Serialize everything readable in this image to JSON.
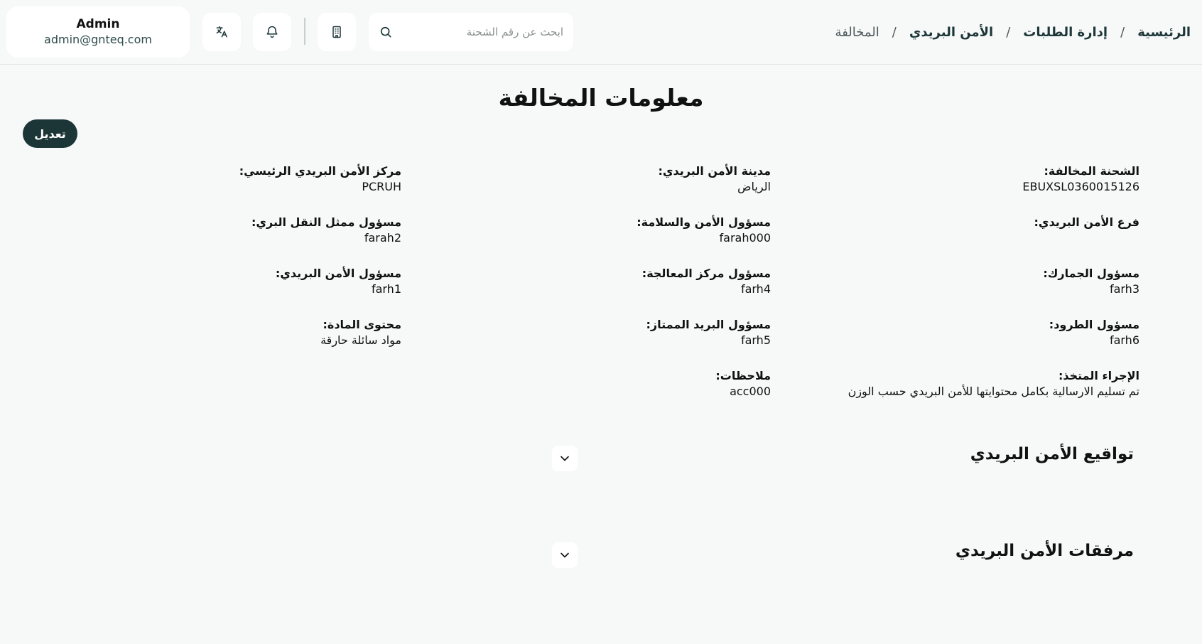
{
  "header": {
    "user": {
      "name": "Admin",
      "email": "admin@gnteq.com"
    },
    "search": {
      "placeholder": "ابحث عن رقم الشحنة"
    },
    "icons": {
      "translate": "translate-icon",
      "notifications": "bell-icon",
      "building": "building-icon",
      "search": "search-icon"
    },
    "breadcrumb": {
      "home": "الرئيسية",
      "requests": "إدارة الطلبات",
      "postal_security": "الأمن البريدي",
      "current": "المخالفة",
      "separator": "/"
    }
  },
  "page": {
    "title": "معلومات المخالفة",
    "edit_label": "تعديل"
  },
  "fields": {
    "shipment": {
      "label": "الشحنة المخالفة:",
      "value": "EBUXSL0360015126"
    },
    "city": {
      "label": "مدينة الأمن البريدي:",
      "value": "الرياض"
    },
    "main_center": {
      "label": "مركز الأمن البريدي الرئيسي:",
      "value": "PCRUH"
    },
    "branch": {
      "label": "فرع الأمن البريدي:",
      "value": ""
    },
    "safety_officer": {
      "label": "مسؤول الأمن والسلامة:",
      "value": "farah000"
    },
    "land_transport": {
      "label": "مسؤول ممثل النقل البري:",
      "value": "farah2"
    },
    "customs": {
      "label": "مسؤول الجمارك:",
      "value": "farh3"
    },
    "processing_center": {
      "label": "مسؤول مركز المعالجة:",
      "value": "farh4"
    },
    "postal_security_officer": {
      "label": "مسؤول الأمن البريدي:",
      "value": "farh1"
    },
    "parcels": {
      "label": "مسؤول الطرود:",
      "value": "farh6"
    },
    "premium_mail": {
      "label": "مسؤول البريد الممتاز:",
      "value": "farh5"
    },
    "content": {
      "label": "محتوى المادة:",
      "value": "مواد سائلة حارقة"
    },
    "action": {
      "label": "الإجراء المتخذ:",
      "value": "تم تسليم الارسالية بكامل محتوايتها للأمن البريدي حسب الوزن"
    },
    "notes": {
      "label": "ملاحظات:",
      "value": "acc000"
    }
  },
  "sections": {
    "signatures": {
      "title": "تواقيع الأمن البريدي",
      "icon": "chevron-down-icon"
    },
    "attachments": {
      "title": "مرفقات الأمن البريدي",
      "icon": "chevron-down-icon"
    }
  },
  "colors": {
    "accent": "#1c3638",
    "background": "#f7f8f8",
    "card": "#ffffff"
  }
}
